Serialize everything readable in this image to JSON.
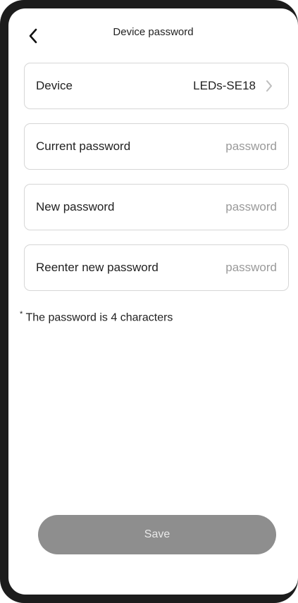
{
  "header": {
    "title": "Device password",
    "back_icon": "chevron-left-icon"
  },
  "fields": {
    "device": {
      "label": "Device",
      "value": "LEDs-SE18",
      "icon": "chevron-right-icon"
    },
    "current_password": {
      "label": "Current password",
      "placeholder": "password"
    },
    "new_password": {
      "label": "New password",
      "placeholder": "password"
    },
    "reenter_password": {
      "label": "Reenter new password",
      "placeholder": "password"
    }
  },
  "note": {
    "asterisk": "*",
    "text": " The password is 4 characters"
  },
  "save_button": {
    "label": "Save"
  },
  "colors": {
    "button_bg": "#8e8e8e",
    "border": "#d6d6d6",
    "placeholder": "#9a9a9a",
    "frame": "#1c1c1c"
  }
}
